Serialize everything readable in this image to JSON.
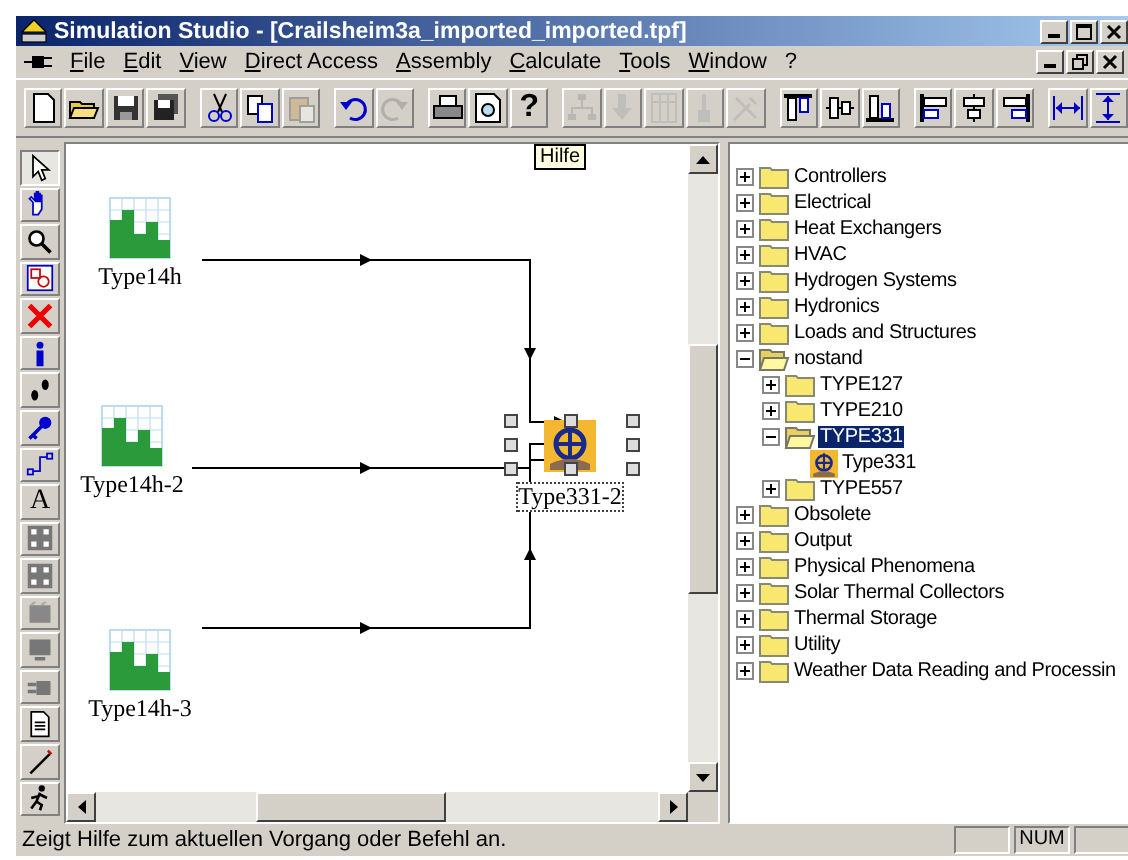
{
  "window": {
    "title": "Simulation Studio - [Crailsheim3a_imported_imported.tpf]"
  },
  "menu": [
    "File",
    "Edit",
    "View",
    "Direct Access",
    "Assembly",
    "Calculate",
    "Tools",
    "Window",
    "?"
  ],
  "toolbar": [
    {
      "kind": "new",
      "disabled": false
    },
    {
      "kind": "open",
      "disabled": false
    },
    {
      "kind": "save",
      "disabled": false
    },
    {
      "kind": "save-all",
      "disabled": false
    },
    {
      "kind": "sep"
    },
    {
      "kind": "cut",
      "disabled": false
    },
    {
      "kind": "copy",
      "disabled": false
    },
    {
      "kind": "paste",
      "disabled": true
    },
    {
      "kind": "sep"
    },
    {
      "kind": "undo",
      "disabled": false
    },
    {
      "kind": "redo",
      "disabled": true
    },
    {
      "kind": "sep"
    },
    {
      "kind": "print",
      "disabled": false
    },
    {
      "kind": "preview",
      "disabled": false
    },
    {
      "kind": "help",
      "glyph": "?",
      "disabled": false
    },
    {
      "kind": "sep"
    },
    {
      "kind": "hierarchy",
      "disabled": true
    },
    {
      "kind": "down",
      "disabled": true
    },
    {
      "kind": "table",
      "disabled": true
    },
    {
      "kind": "brush",
      "disabled": true
    },
    {
      "kind": "tools",
      "disabled": true
    },
    {
      "kind": "sep"
    },
    {
      "kind": "align-top",
      "disabled": false
    },
    {
      "kind": "align-middle",
      "disabled": false
    },
    {
      "kind": "align-bottom",
      "disabled": false
    },
    {
      "kind": "sep"
    },
    {
      "kind": "align-left",
      "disabled": false
    },
    {
      "kind": "align-center",
      "disabled": false
    },
    {
      "kind": "align-right",
      "disabled": false
    },
    {
      "kind": "sep"
    },
    {
      "kind": "space-h",
      "disabled": false
    },
    {
      "kind": "space-v",
      "disabled": false
    }
  ],
  "tooltip": "Hilfe",
  "side_toolbar": [
    {
      "kind": "pointer",
      "selected": true
    },
    {
      "kind": "hand",
      "selected": false
    },
    {
      "kind": "zoom",
      "selected": false
    },
    {
      "kind": "select-box",
      "selected": false
    },
    {
      "kind": "delete",
      "selected": false
    },
    {
      "kind": "info",
      "selected": false
    },
    {
      "kind": "footsteps",
      "selected": false
    },
    {
      "kind": "key",
      "selected": false
    },
    {
      "kind": "connect",
      "selected": false
    },
    {
      "kind": "text",
      "glyph": "A",
      "selected": false
    },
    {
      "kind": "grid",
      "selected": false
    },
    {
      "kind": "grid",
      "selected": false
    },
    {
      "kind": "macro",
      "selected": false
    },
    {
      "kind": "monitor",
      "selected": false
    },
    {
      "kind": "plug",
      "selected": false
    },
    {
      "kind": "document",
      "selected": false
    },
    {
      "kind": "pen",
      "selected": false
    },
    {
      "kind": "runner",
      "selected": false
    }
  ],
  "canvas": {
    "nodes": [
      {
        "kind": "profile",
        "label": "Type14h",
        "selected": false
      },
      {
        "kind": "profile",
        "label": "Type14h-2",
        "selected": false
      },
      {
        "kind": "profile",
        "label": "Type14h-3",
        "selected": false
      },
      {
        "kind": "component",
        "label": "Type331-2",
        "selected": true
      }
    ]
  },
  "tree": [
    {
      "kind": "folder",
      "label": "Controllers",
      "expanded": false,
      "selected": false
    },
    {
      "kind": "folder",
      "label": "Electrical",
      "expanded": false,
      "selected": false
    },
    {
      "kind": "folder",
      "label": "Heat Exchangers",
      "expanded": false,
      "selected": false
    },
    {
      "kind": "folder",
      "label": "HVAC",
      "expanded": false,
      "selected": false
    },
    {
      "kind": "folder",
      "label": "Hydrogen Systems",
      "expanded": false,
      "selected": false
    },
    {
      "kind": "folder",
      "label": "Hydronics",
      "expanded": false,
      "selected": false
    },
    {
      "kind": "folder",
      "label": "Loads and Structures",
      "expanded": false,
      "selected": false
    },
    {
      "kind": "folder",
      "label": "nostand",
      "expanded": true,
      "selected": false,
      "children": [
        {
          "kind": "folder",
          "label": "TYPE127",
          "expanded": false,
          "selected": false
        },
        {
          "kind": "folder",
          "label": "TYPE210",
          "expanded": false,
          "selected": false
        },
        {
          "kind": "folder",
          "label": "TYPE331",
          "expanded": true,
          "selected": true,
          "children": [
            {
              "kind": "component",
              "label": "Type331",
              "selected": false
            }
          ]
        },
        {
          "kind": "folder",
          "label": "TYPE557",
          "expanded": false,
          "selected": false
        }
      ]
    },
    {
      "kind": "folder",
      "label": "Obsolete",
      "expanded": false,
      "selected": false
    },
    {
      "kind": "folder",
      "label": "Output",
      "expanded": false,
      "selected": false
    },
    {
      "kind": "folder",
      "label": "Physical Phenomena",
      "expanded": false,
      "selected": false
    },
    {
      "kind": "folder",
      "label": "Solar Thermal Collectors",
      "expanded": false,
      "selected": false
    },
    {
      "kind": "folder",
      "label": "Thermal Storage",
      "expanded": false,
      "selected": false
    },
    {
      "kind": "folder",
      "label": "Utility",
      "expanded": false,
      "selected": false
    },
    {
      "kind": "folder",
      "label": "Weather Data Reading and Processin",
      "expanded": false,
      "selected": false
    }
  ],
  "status_bar": {
    "message": "Zeigt Hilfe zum aktuellen Vorgang oder Befehl an.",
    "indicators": [
      "NUM"
    ]
  }
}
